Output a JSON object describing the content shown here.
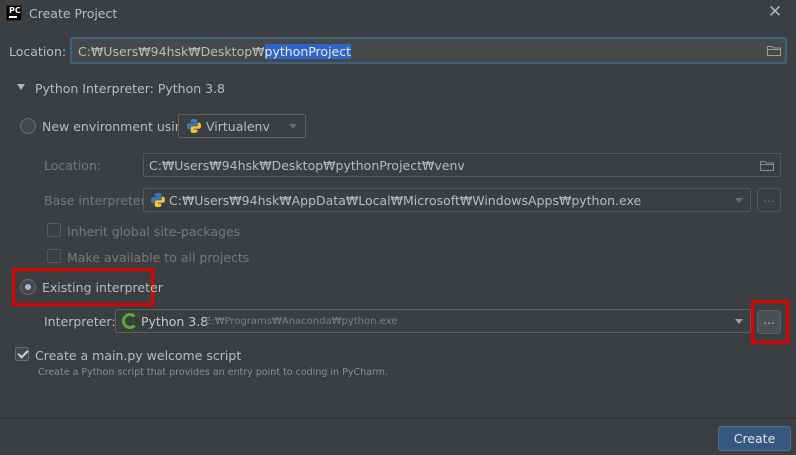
{
  "window": {
    "title": "Create Project",
    "app_icon_text": "PC"
  },
  "location": {
    "label": "Location:",
    "value_prefix": "C:₩Users₩94hsk₩Desktop₩",
    "value_selected": "pythonProject"
  },
  "interpreter_section": {
    "title": "Python Interpreter: Python 3.8"
  },
  "new_env": {
    "radio_label": "New environment using",
    "tool": "Virtualenv",
    "location_label": "Location:",
    "location_value": "C:₩Users₩94hsk₩Desktop₩pythonProject₩venv",
    "base_label": "Base interpreter:",
    "base_value": "C:₩Users₩94hsk₩AppData₩Local₩Microsoft₩WindowsApps₩python.exe",
    "inherit_label": "Inherit global site-packages",
    "available_label": "Make available to all projects"
  },
  "existing": {
    "radio_label": "Existing interpreter",
    "interpreter_label": "Interpreter:",
    "interpreter_name": "Python 3.8",
    "interpreter_path": "E:₩Programs₩Anaconda₩python.exe",
    "browse_label": "..."
  },
  "welcome_script": {
    "label": "Create a main.py welcome script",
    "help": "Create a Python script that provides an entry point to coding in PyCharm."
  },
  "footer": {
    "create_label": "Create"
  },
  "colors": {
    "background": "#3c3f41",
    "selection": "#2f65ca",
    "focus_border": "#3d6185",
    "highlight_red": "#e00000",
    "primary_button": "#365880"
  },
  "icons": [
    "pycharm-logo",
    "close-icon",
    "folder-icon",
    "expand-triangle-icon",
    "python-icon",
    "chevron-down-icon",
    "spinner-icon",
    "check-icon"
  ]
}
